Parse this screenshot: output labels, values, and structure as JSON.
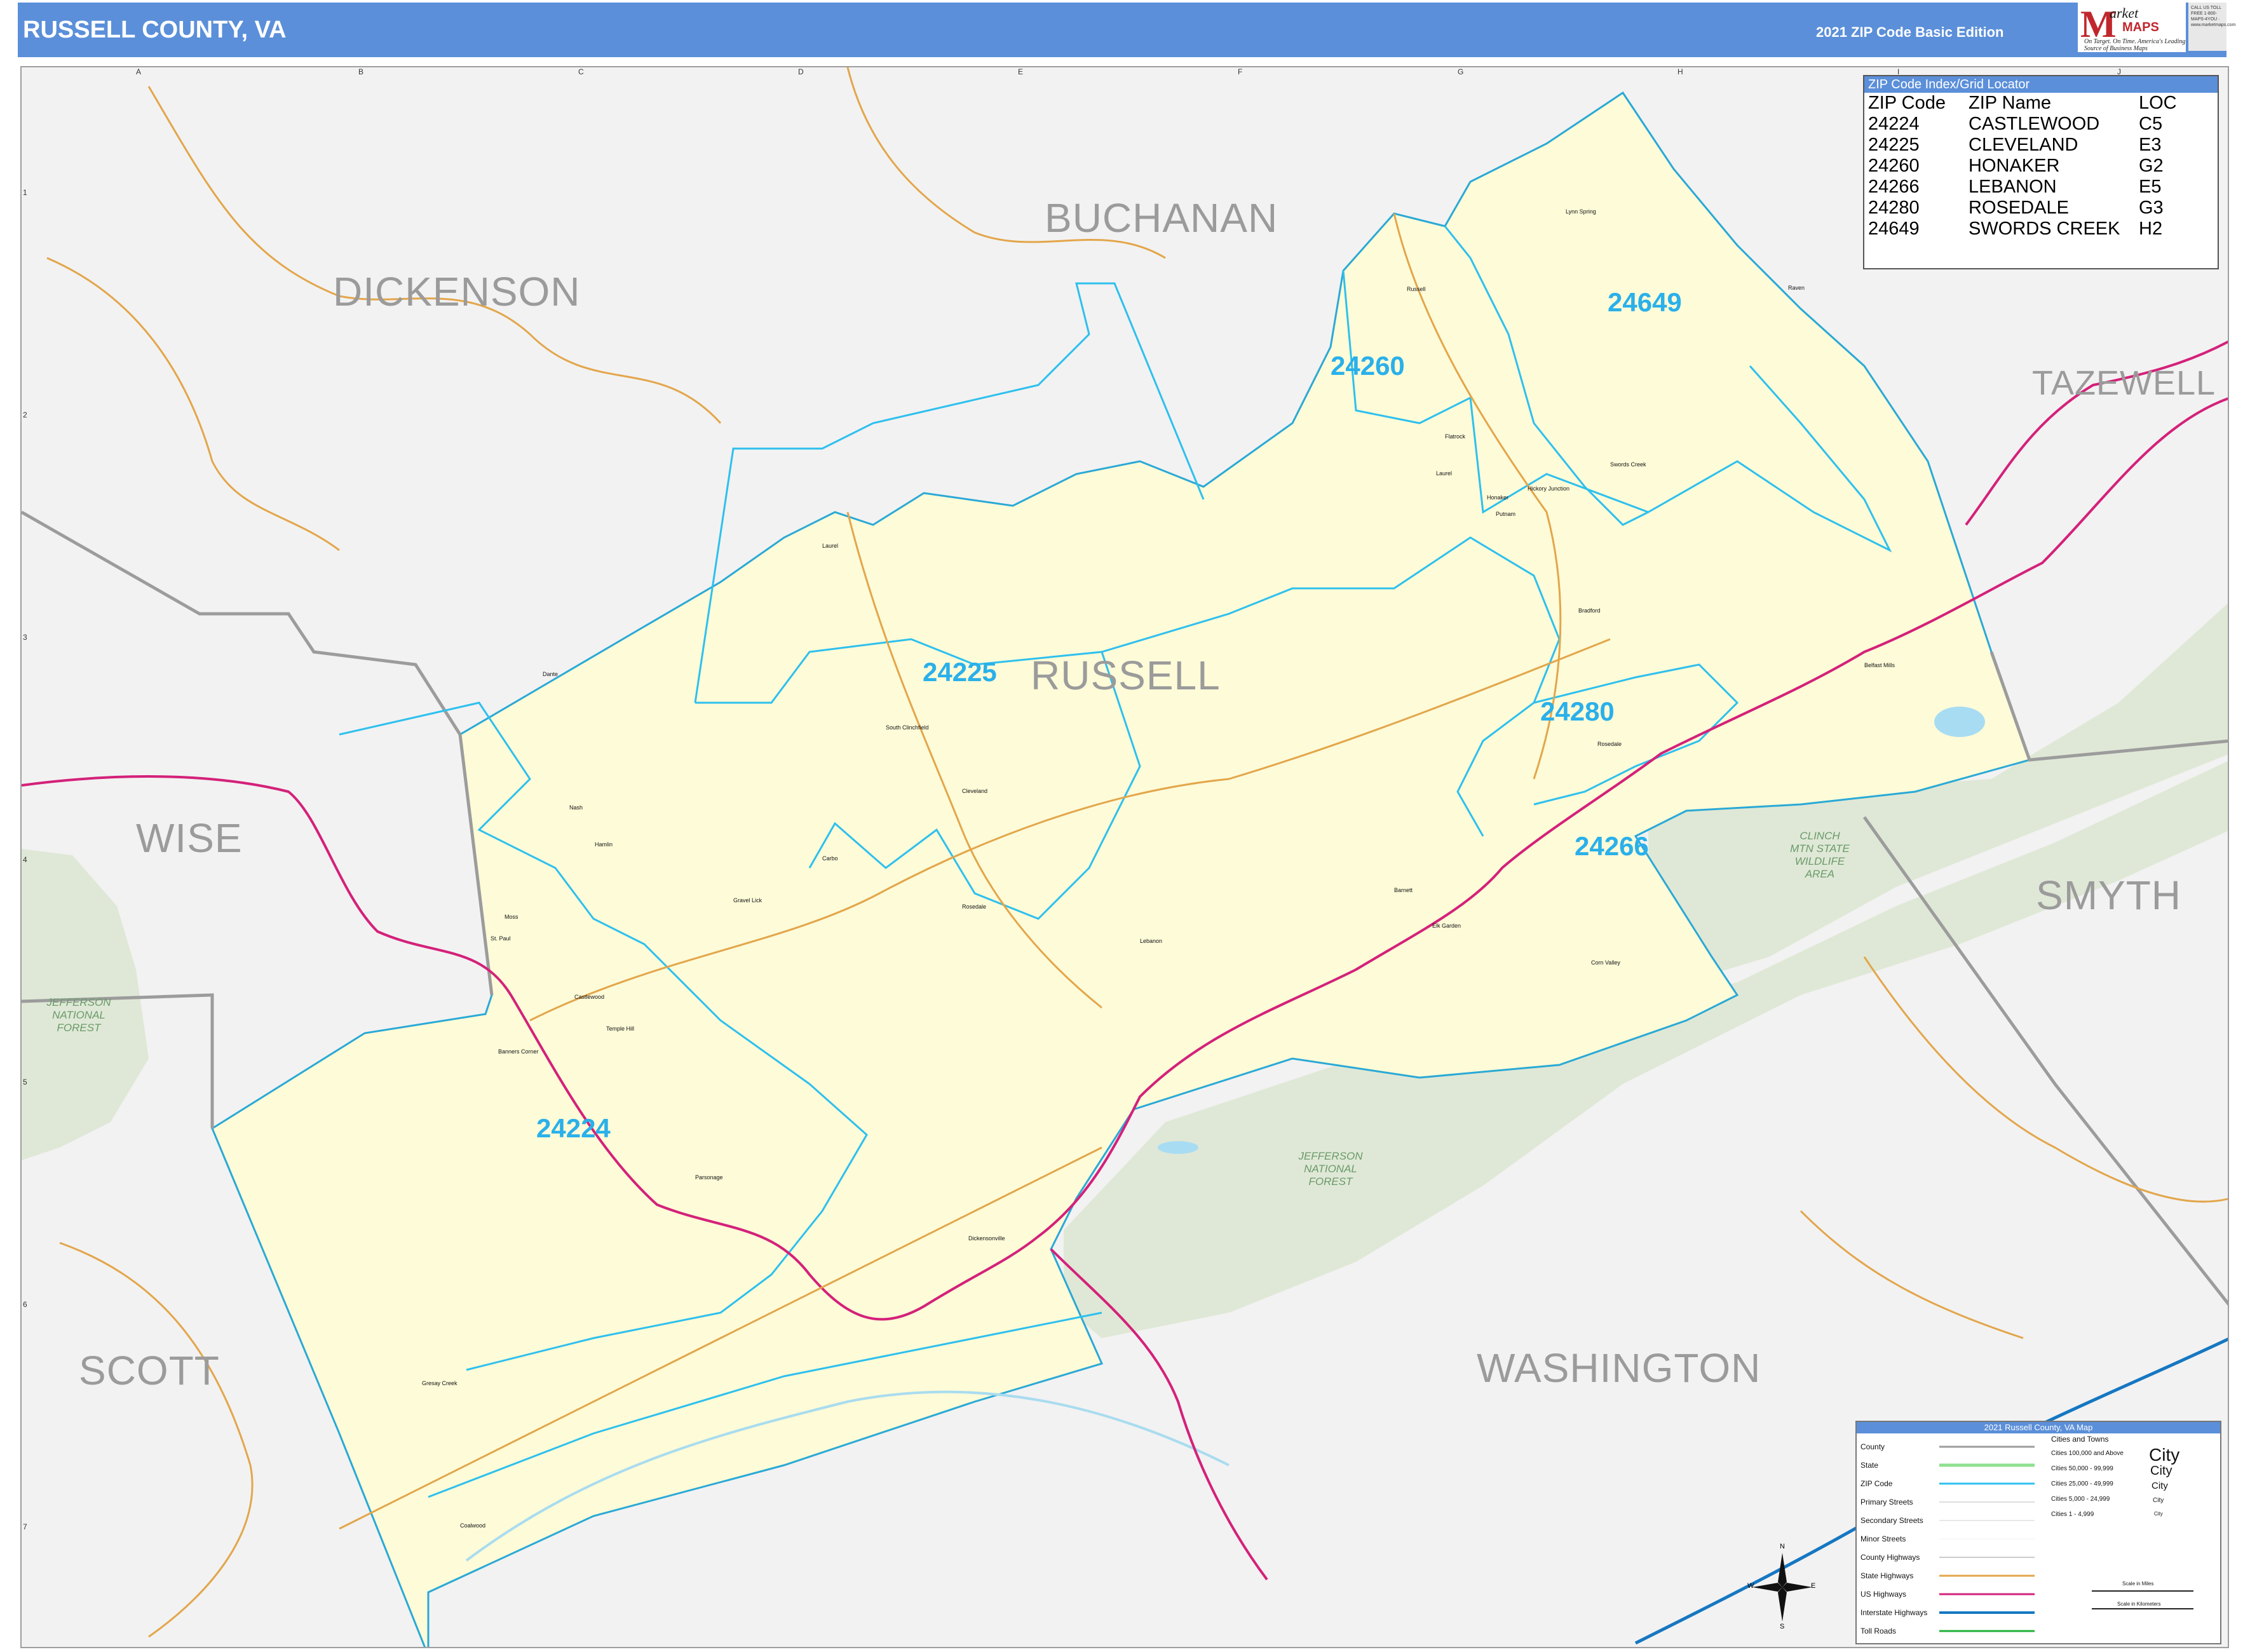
{
  "header": {
    "title": "RUSSELL COUNTY, VA",
    "edition": "2021 ZIP Code Basic Edition"
  },
  "logo": {
    "letter": "M",
    "word1": "arket",
    "word2": "MAPS",
    "tagline": "On Target. On Time. America's Leading Source of Business Maps",
    "side_text": "CALL US TOLL FREE 1-800-MAPS-4YOU · www.marketmaps.com"
  },
  "counties": {
    "buchanan": "BUCHANAN",
    "dickenson": "DICKENSON",
    "tazewell": "TAZEWELL",
    "wise": "WISE",
    "russell": "RUSSELL",
    "smyth": "SMYTH",
    "scott": "SCOTT",
    "washington": "WASHINGTON"
  },
  "zip_labels": [
    "24649",
    "24260",
    "24225",
    "24280",
    "24266",
    "24224"
  ],
  "forests": {
    "jefferson_west": "JEFFERSON NATIONAL FOREST",
    "jefferson_south": "JEFFERSON NATIONAL FOREST",
    "clinch": "CLINCH MTN STATE WILDLIFE AREA"
  },
  "grid": {
    "columns": [
      "A",
      "B",
      "C",
      "D",
      "E",
      "F",
      "G",
      "H",
      "I",
      "J"
    ],
    "rows": [
      "1",
      "2",
      "3",
      "4",
      "5",
      "6",
      "7"
    ]
  },
  "zip_index": {
    "title": "ZIP Code Index/Grid Locator",
    "headers": [
      "ZIP Code",
      "ZIP Name",
      "LOC"
    ],
    "rows": [
      [
        "24224",
        "CASTLEWOOD",
        "C5"
      ],
      [
        "24225",
        "CLEVELAND",
        "E3"
      ],
      [
        "24260",
        "HONAKER",
        "G2"
      ],
      [
        "24266",
        "LEBANON",
        "E5"
      ],
      [
        "24280",
        "ROSEDALE",
        "G3"
      ],
      [
        "24649",
        "SWORDS CREEK",
        "H2"
      ]
    ]
  },
  "legend": {
    "title": "2021 Russell County, VA Map",
    "items": [
      "County",
      "State",
      "ZIP Code",
      "Primary Streets",
      "Secondary Streets",
      "Minor Streets",
      "County Highways",
      "State Highways",
      "US Highways",
      "Interstate Highways",
      "Toll Roads"
    ],
    "cities_title": "Cities and Towns",
    "city_classes": [
      "Cities 100,000 and Above",
      "Cities 50,000 - 99,999",
      "Cities 25,000 - 49,999",
      "Cities 5,000 - 24,999",
      "Cities 1 - 4,999"
    ],
    "city_word": "City",
    "scale_miles": "Scale in Miles",
    "scale_km": "Scale in Kilometers",
    "compass": [
      "N",
      "S",
      "E",
      "W"
    ]
  },
  "towns": [
    "Lynn Spring",
    "Russell",
    "Raven",
    "Flatrock",
    "Laurel",
    "Swords Creek",
    "Hickory Junction",
    "Honaker",
    "Putnam",
    "Bradford",
    "Belfast Mills",
    "Rosedale",
    "Laurel",
    "South Clinchfield",
    "Cleveland",
    "Carbo",
    "Castlewood",
    "Temple Hill",
    "Lebanon",
    "Barnett",
    "Elk Garden",
    "Corn Valley",
    "Dante",
    "Nash",
    "Hamlin",
    "Moss",
    "St. Paul",
    "Banners Corner",
    "Parsonage",
    "Rosedale",
    "Gravel Lick",
    "Gresay Creek",
    "Dickensonville",
    "Coalwood"
  ]
}
